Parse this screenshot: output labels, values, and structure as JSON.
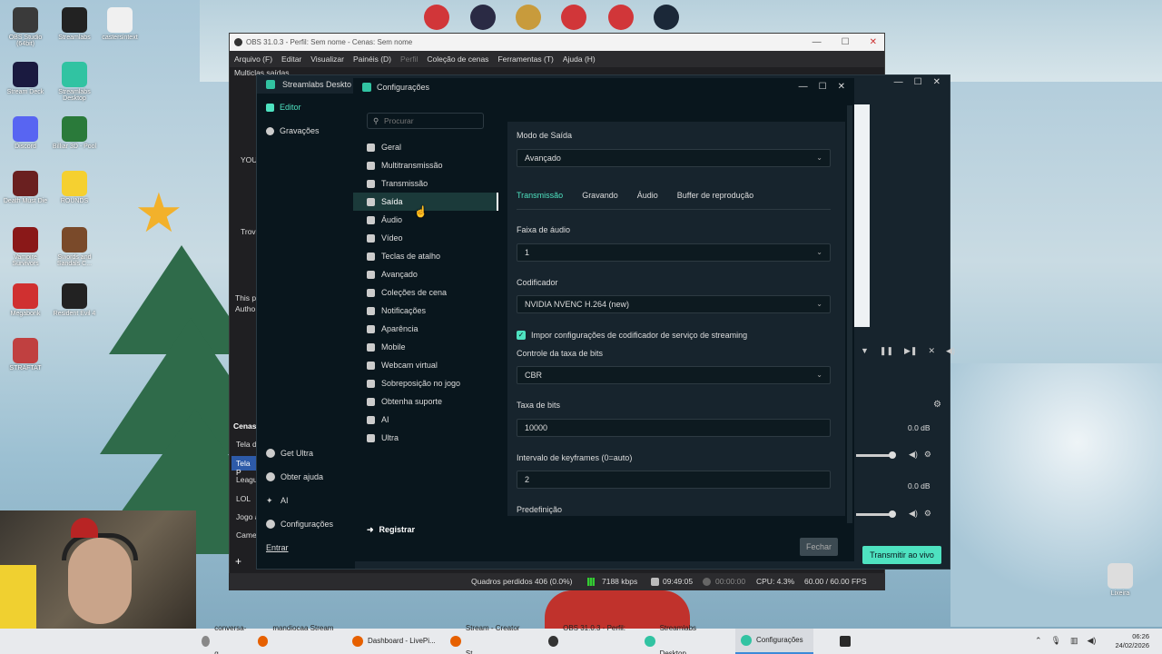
{
  "desktop_icons": [
    {
      "label": "OBS Studio (64bit)",
      "color": "#3a3a3a"
    },
    {
      "label": "Streamlabs",
      "color": "#222"
    },
    {
      "label": "castersintext",
      "color": "#f0f0f0"
    },
    {
      "label": "Stream Deck",
      "color": "#1a1a40"
    },
    {
      "label": "Streamlabs Desktop",
      "color": "#31c3a2"
    },
    {
      "label": "Discord",
      "color": "#5865f2"
    },
    {
      "label": "Billiar 3D - Pool",
      "color": "#2a7a3a"
    },
    {
      "label": "Death Must Die",
      "color": "#6a2020"
    },
    {
      "label": "ROUNDS",
      "color": "#f5d030"
    },
    {
      "label": "Vampire Survivors",
      "color": "#8a1818"
    },
    {
      "label": "Swords and Sandals C...",
      "color": "#7a4a2a"
    },
    {
      "label": "Megabonk",
      "color": "#d03030"
    },
    {
      "label": "Resident Evil 4",
      "color": "#222"
    },
    {
      "label": "STRAFTAT",
      "color": "#c04040"
    },
    {
      "label": "Lixeira",
      "color": "#ddd"
    }
  ],
  "top_icons": [
    {
      "name": "riot-client-icon",
      "color": "#d13639"
    },
    {
      "name": "valorant-icon",
      "color": "#2a2a44"
    },
    {
      "name": "league-of-legends-icon",
      "color": "#c89b3c"
    },
    {
      "name": "riot-client-icon-2",
      "color": "#d13639"
    },
    {
      "name": "riot-client-icon-3",
      "color": "#d13639"
    },
    {
      "name": "steam-icon",
      "color": "#1b2838"
    }
  ],
  "obs": {
    "title": "OBS 31.0.3 - Perfil: Sem nome - Cenas: Sem nome",
    "menu": [
      "Arquivo (F)",
      "Editar",
      "Visualizar",
      "Painéis (D)",
      "Perfil",
      "Coleção de cenas",
      "Ferramentas (T)",
      "Ajuda (H)"
    ],
    "partial_labels": {
      "multiview": "Multiclas saídas",
      "you": "YOU",
      "trov": "Trov",
      "this": "This p",
      "autho": "Autho",
      "cenas": "Cenas",
      "tela_d": "Tela d",
      "tela_p": "Tela P",
      "leagu": "Leagu",
      "lol": "LOL",
      "jogo": "Jogo a",
      "came": "Came"
    },
    "status": {
      "dropped": "Quadros perdidos 406 (0.0%)",
      "kbps": "7188 kbps",
      "time1": "09:49:05",
      "time2": "00:00:00",
      "cpu": "CPU: 4.3%",
      "fps": "60.00 / 60.00 FPS"
    }
  },
  "streamlabs": {
    "title": "Streamlabs Deskto",
    "side": [
      {
        "label": "Editor"
      },
      {
        "label": "Gravações"
      }
    ],
    "side_bottom": [
      {
        "label": "Get Ultra"
      },
      {
        "label": "Obter ajuda"
      },
      {
        "label": "AI"
      },
      {
        "label": "Configurações"
      }
    ],
    "login": "Entrar",
    "go_live": "Transmitir ao vivo",
    "db1": "0.0 dB",
    "db2": "0.0 dB"
  },
  "config": {
    "title": "Configurações",
    "search_placeholder": "Procurar",
    "nav": [
      {
        "label": "Geral"
      },
      {
        "label": "Multitransmissão"
      },
      {
        "label": "Transmissão"
      },
      {
        "label": "Saída",
        "active": true
      },
      {
        "label": "Áudio"
      },
      {
        "label": "Vídeo"
      },
      {
        "label": "Teclas de atalho"
      },
      {
        "label": "Avançado"
      },
      {
        "label": "Coleções de cena"
      },
      {
        "label": "Notificações"
      },
      {
        "label": "Aparência"
      },
      {
        "label": "Mobile"
      },
      {
        "label": "Webcam virtual"
      },
      {
        "label": "Sobreposição no jogo"
      },
      {
        "label": "Obtenha suporte"
      },
      {
        "label": "AI"
      },
      {
        "label": "Ultra"
      }
    ],
    "register": "Registrar",
    "output_mode_label": "Modo de Saída",
    "output_mode_value": "Avançado",
    "tabs": [
      {
        "label": "Transmissão",
        "active": true
      },
      {
        "label": "Gravando"
      },
      {
        "label": "Áudio"
      },
      {
        "label": "Buffer de reprodução"
      }
    ],
    "audio_track_label": "Faixa de áudio",
    "audio_track_value": "1",
    "encoder_label": "Codificador",
    "encoder_value": "NVIDIA NVENC H.264 (new)",
    "enforce_label": "Impor configurações de codificador de serviço de streaming",
    "enforce_checked": true,
    "rate_control_label": "Controle da taxa de bits",
    "rate_control_value": "CBR",
    "bitrate_label": "Taxa de bits",
    "bitrate_value": "10000",
    "keyframe_label": "Intervalo de keyframes (0=auto)",
    "keyframe_value": "2",
    "preset_label": "Predefinição",
    "close": "Fechar"
  },
  "taskbar": [
    {
      "label": "conversa-g...",
      "color": "#888"
    },
    {
      "label": "mandiocaa Stream ...",
      "color": "#e66000"
    },
    {
      "label": "Dashboard - LivePi...",
      "color": "#e66000"
    },
    {
      "label": "Stream - Creator St...",
      "color": "#e66000"
    },
    {
      "label": "OBS 31.0.3 - Perfil: ...",
      "color": "#333"
    },
    {
      "label": "Streamlabs Desktop",
      "color": "#31c3a2"
    },
    {
      "label": "Configurações",
      "color": "#31c3a2",
      "active": true
    }
  ],
  "clock": {
    "time": "06:26",
    "date": "24/02/2026"
  }
}
